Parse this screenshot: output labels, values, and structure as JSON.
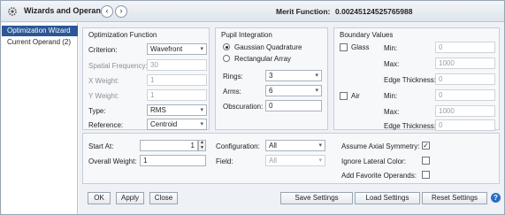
{
  "titlebar": {
    "title": "Wizards and Operands",
    "back_icon": "chevron-left-icon",
    "forward_icon": "chevron-right-icon",
    "back_glyph": "‹",
    "forward_glyph": "›",
    "merit_label": "Merit Function:",
    "merit_value": "0.00245124525765988"
  },
  "sidebar": {
    "items": [
      {
        "label": "Optimization Wizard",
        "selected": true
      },
      {
        "label": "Current Operand (2)",
        "selected": false
      }
    ]
  },
  "optimization_function": {
    "title": "Optimization Function",
    "criterion_label": "Criterion:",
    "criterion_value": "Wavefront",
    "spatial_frequency_label": "Spatial Frequency:",
    "spatial_frequency_value": "30",
    "x_weight_label": "X Weight:",
    "x_weight_value": "1",
    "y_weight_label": "Y Weight:",
    "y_weight_value": "1",
    "type_label": "Type:",
    "type_value": "RMS",
    "reference_label": "Reference:",
    "reference_value": "Centroid"
  },
  "pupil_integration": {
    "title": "Pupil Integration",
    "gaussian_label": "Gaussian Quadrature",
    "gaussian_selected": true,
    "rectangular_label": "Rectangular Array",
    "rectangular_selected": false,
    "rings_label": "Rings:",
    "rings_value": "3",
    "arms_label": "Arms:",
    "arms_value": "6",
    "obscuration_label": "Obscuration:",
    "obscuration_value": "0"
  },
  "boundary_values": {
    "title": "Boundary Values",
    "glass_label": "Glass",
    "glass_checked": false,
    "glass_min_label": "Min:",
    "glass_min_value": "0",
    "glass_max_label": "Max:",
    "glass_max_value": "1000",
    "glass_edge_label": "Edge Thickness:",
    "glass_edge_value": "0",
    "air_label": "Air",
    "air_checked": false,
    "air_min_label": "Min:",
    "air_min_value": "0",
    "air_max_label": "Max:",
    "air_max_value": "1000",
    "air_edge_label": "Edge Thickness:",
    "air_edge_value": "0"
  },
  "lower": {
    "start_at_label": "Start At:",
    "start_at_value": "1",
    "overall_weight_label": "Overall Weight:",
    "overall_weight_value": "1",
    "configuration_label": "Configuration:",
    "configuration_value": "All",
    "field_label": "Field:",
    "field_value": "All",
    "assume_axial_label": "Assume Axial Symmetry:",
    "assume_axial_checked": true,
    "ignore_lateral_label": "Ignore Lateral Color:",
    "ignore_lateral_checked": false,
    "add_favorite_label": "Add Favorite Operands:",
    "add_favorite_checked": false
  },
  "buttons": {
    "ok": "OK",
    "apply": "Apply",
    "close": "Close",
    "save_settings": "Save Settings",
    "load_settings": "Load Settings",
    "reset_settings": "Reset Settings",
    "help_glyph": "?"
  },
  "symbols": {
    "dropdown": "▾",
    "check": "✓",
    "spin_up": "▲",
    "spin_down": "▼"
  },
  "colors": {
    "selection": "#2b5797",
    "help": "#2b6cc4"
  }
}
